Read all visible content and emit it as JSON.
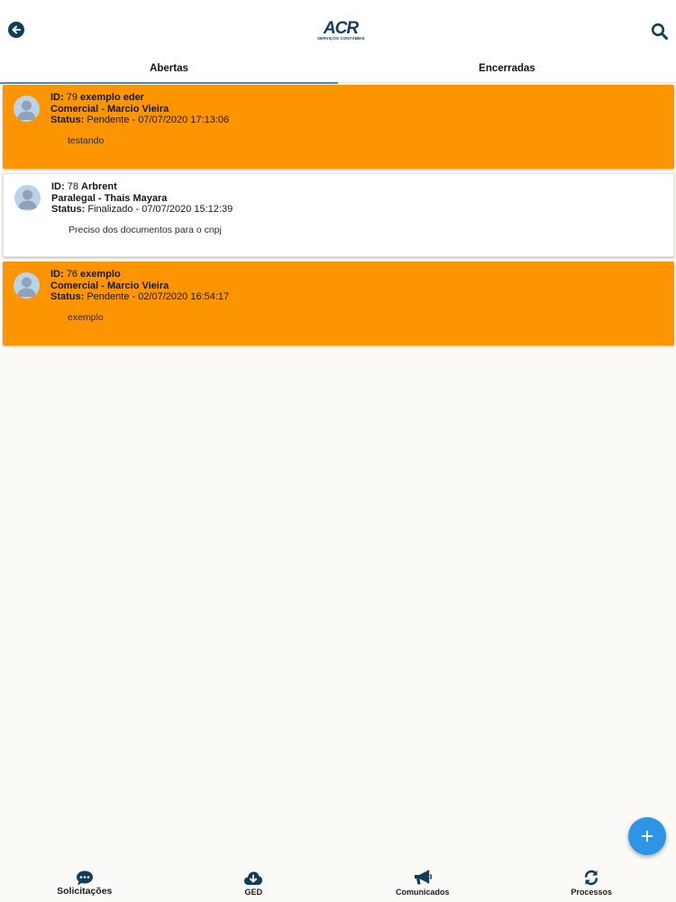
{
  "header": {
    "logo_text": "ACR",
    "logo_subtext": "SERVIÇOS CONTÁBEIS",
    "back_icon": "arrow-left-circle-icon",
    "search_icon": "search-icon"
  },
  "tabs": [
    {
      "label": "Abertas",
      "active": true
    },
    {
      "label": "Encerradas",
      "active": false
    }
  ],
  "tickets": [
    {
      "id_label": "ID:",
      "id": "79",
      "title": "exemplo eder",
      "department": "Comercial - Marcio Vieira",
      "status_label": "Status:",
      "status": "Pendente - 07/07/2020 17:13:06",
      "message": "testando",
      "state": "pending"
    },
    {
      "id_label": "ID:",
      "id": "78",
      "title": "Arbrent",
      "department": "Paralegal - Thais Mayara",
      "status_label": "Status:",
      "status": "Finalizado - 07/07/2020 15:12:39",
      "message": "Preciso dos documentos para o cnpj",
      "state": "done"
    },
    {
      "id_label": "ID:",
      "id": "76",
      "title": "exemplo",
      "department": "Comercial - Marcio Vieira",
      "status_label": "Status:",
      "status": "Pendente - 02/07/2020 16:54:17",
      "message": "exemplo",
      "state": "pending"
    }
  ],
  "colors": {
    "pending": "#fd9500",
    "done": "#ffffff",
    "accent": "#2d95e6",
    "brand": "#163c63"
  },
  "fab": {
    "icon": "plus-icon"
  },
  "bottom_nav": [
    {
      "label": "Solicitações",
      "icon": "chat-bubble-icon",
      "active": true
    },
    {
      "label": "GED",
      "icon": "cloud-download-icon",
      "active": false
    },
    {
      "label": "Comunicados",
      "icon": "megaphone-icon",
      "active": false
    },
    {
      "label": "Processos",
      "icon": "refresh-icon",
      "active": false
    }
  ]
}
